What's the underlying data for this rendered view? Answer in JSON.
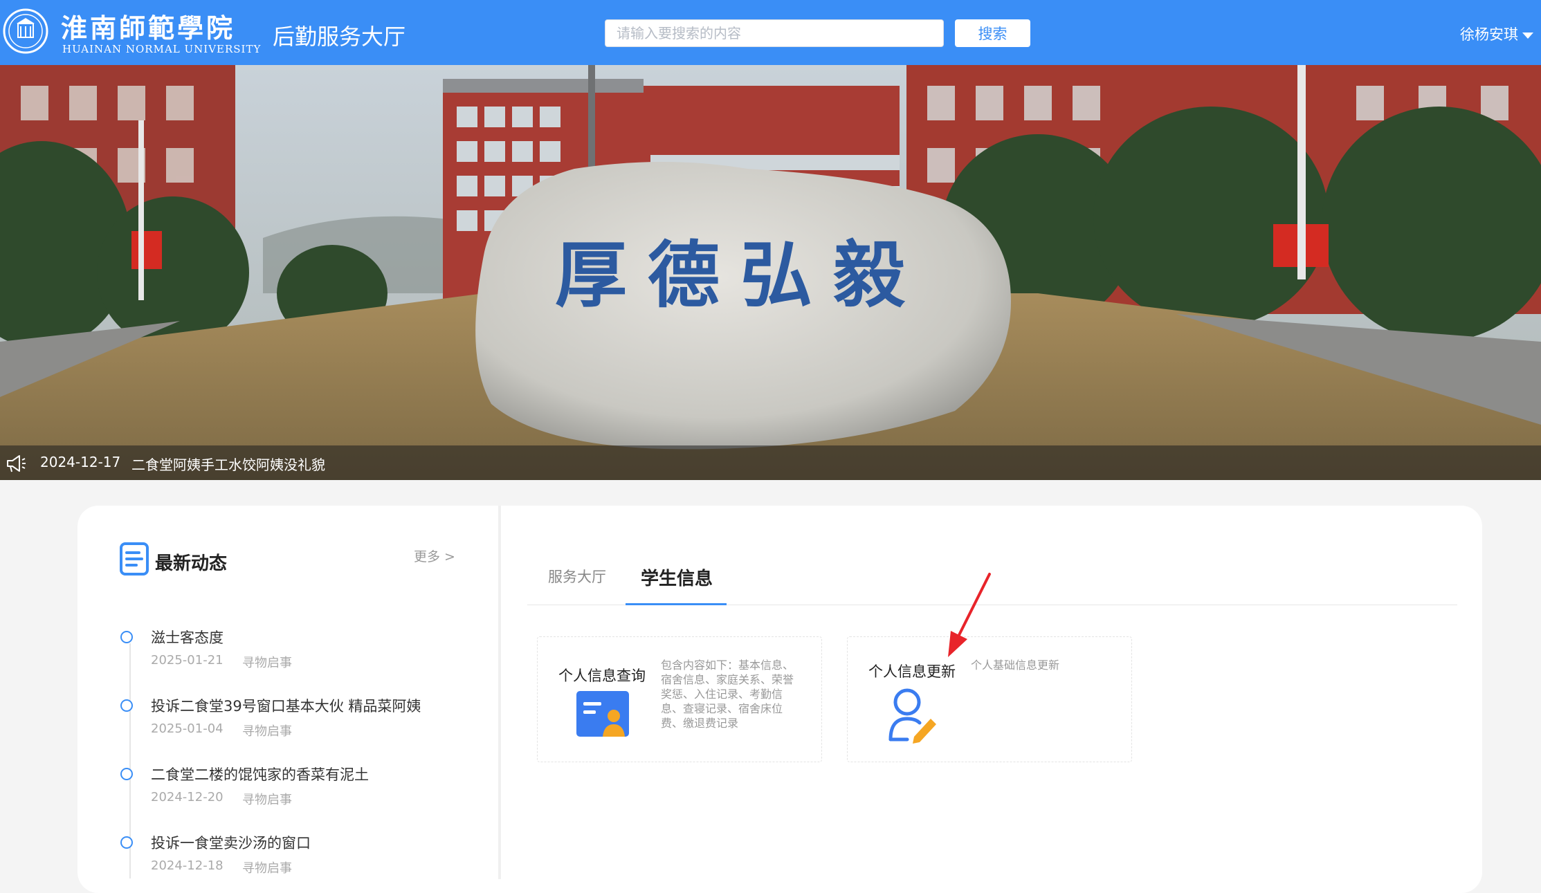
{
  "header": {
    "logo_cn": "淮南師範學院",
    "logo_en": "HUAINAN NORMAL UNIVERSITY",
    "app_title": "后勤服务大厅",
    "search_placeholder": "请输入要搜索的内容",
    "search_button": "搜索",
    "user_name": "徐杨安琪"
  },
  "banner": {
    "stone_inscription": "厚德弘毅",
    "notice": {
      "date": "2024-12-17",
      "text": "二食堂阿姨手工水饺阿姨没礼貌"
    }
  },
  "news": {
    "title": "最新动态",
    "more": "更多 >",
    "items": [
      {
        "title": "滋士客态度",
        "date": "2025-01-21",
        "category": "寻物启事"
      },
      {
        "title": "投诉二食堂39号窗口基本大伙 精品菜阿姨",
        "date": "2025-01-04",
        "category": "寻物启事"
      },
      {
        "title": "二食堂二楼的馄饨家的香菜有泥土",
        "date": "2024-12-20",
        "category": "寻物启事"
      },
      {
        "title": "投诉一食堂卖沙汤的窗口",
        "date": "2024-12-18",
        "category": "寻物启事"
      }
    ]
  },
  "tabs": [
    {
      "label": "服务大厅",
      "active": false
    },
    {
      "label": "学生信息",
      "active": true
    }
  ],
  "services": [
    {
      "title": "个人信息查询",
      "description": "包含内容如下：基本信息、宿舍信息、家庭关系、荣誉奖惩、入住记录、考勤信息、查寝记录、宿舍床位费、缴退费记录",
      "icon": "id-card-icon"
    },
    {
      "title": "个人信息更新",
      "description": "个人基础信息更新",
      "icon": "user-edit-icon"
    }
  ],
  "colors": {
    "primary": "#3a8ef6",
    "accent_orange": "#f5a623",
    "annotation_red": "#e8242a"
  }
}
